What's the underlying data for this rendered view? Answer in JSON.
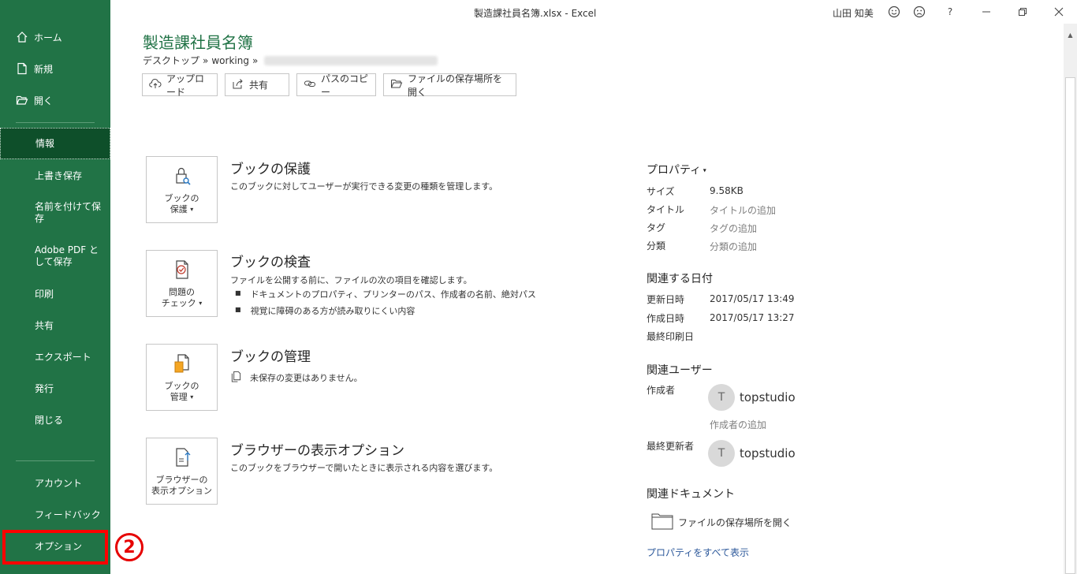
{
  "window": {
    "title": "製造課社員名簿.xlsx  -  Excel",
    "user": "山田 知美",
    "help": "?"
  },
  "sidebar": {
    "home": "ホーム",
    "new": "新規",
    "open": "開く",
    "info": "情報",
    "save": "上書き保存",
    "save_as": "名前を付けて保存",
    "save_pdf": "Adobe PDF として保存",
    "print": "印刷",
    "share": "共有",
    "export": "エクスポート",
    "publish": "発行",
    "close": "閉じる",
    "account": "アカウント",
    "feedback": "フィードバック",
    "options": "オプション"
  },
  "annotation": {
    "step": "2"
  },
  "header": {
    "title": "製造課社員名簿",
    "breadcrumb_a": "デスクトップ",
    "breadcrumb_sep": "»",
    "breadcrumb_b": "working",
    "buttons": {
      "upload": "アップロード",
      "share": "共有",
      "copy_path": "パスのコピー",
      "open_location": "ファイルの保存場所を開く"
    }
  },
  "sections": {
    "protect": {
      "tile": [
        "ブックの",
        "保護"
      ],
      "title": "ブックの保護",
      "desc": "このブックに対してユーザーが実行できる変更の種類を管理します。"
    },
    "inspect": {
      "tile": [
        "問題の",
        "チェック"
      ],
      "title": "ブックの検査",
      "desc": "ファイルを公開する前に、ファイルの次の項目を確認します。",
      "bullets": [
        "ドキュメントのプロパティ、プリンターのパス、作成者の名前、絶対パス",
        "視覚に障碍のある方が読み取りにくい内容"
      ]
    },
    "manage": {
      "tile": [
        "ブックの",
        "管理"
      ],
      "title": "ブックの管理",
      "desc": "未保存の変更はありません。"
    },
    "browser": {
      "tile": [
        "ブラウザーの",
        "表示オプション"
      ],
      "title": "ブラウザーの表示オプション",
      "desc": "このブックをブラウザーで開いたときに表示される内容を選びます。"
    }
  },
  "properties": {
    "heading": "プロパティ",
    "size_label": "サイズ",
    "size_value": "9.58KB",
    "title_label": "タイトル",
    "title_placeholder": "タイトルの追加",
    "tag_label": "タグ",
    "tag_placeholder": "タグの追加",
    "category_label": "分類",
    "category_placeholder": "分類の追加",
    "dates_heading": "関連する日付",
    "modified_label": "更新日時",
    "modified_value": "2017/05/17 13:49",
    "created_label": "作成日時",
    "created_value": "2017/05/17 13:27",
    "printed_label": "最終印刷日",
    "users_heading": "関連ユーザー",
    "author_label": "作成者",
    "author_initial": "T",
    "author_name": "topstudio",
    "add_author": "作成者の追加",
    "last_modified_by_label": "最終更新者",
    "last_modified_initial": "T",
    "last_modified_name": "topstudio",
    "docs_heading": "関連ドキュメント",
    "open_location": "ファイルの保存場所を開く",
    "show_all": "プロパティをすべて表示"
  }
}
